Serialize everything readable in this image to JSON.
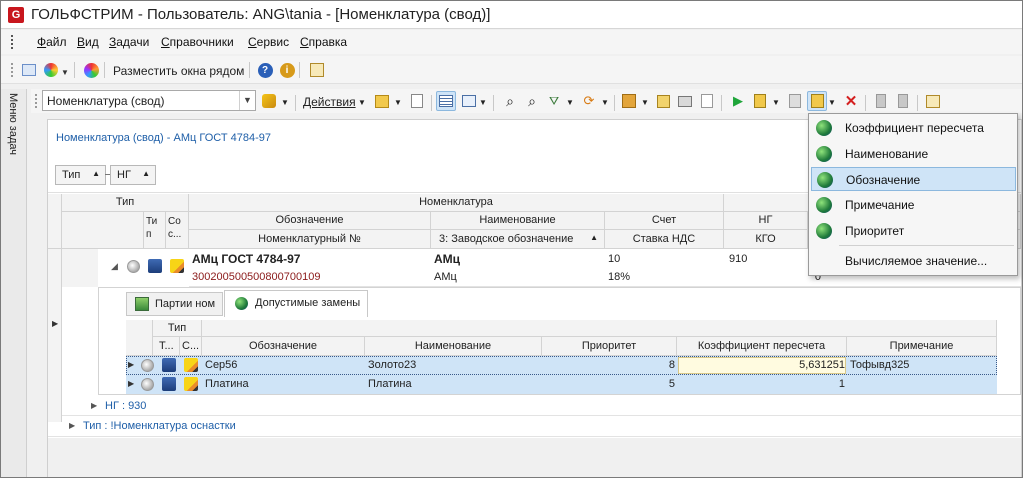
{
  "window": {
    "title": "ГОЛЬФСТРИМ - Пользователь: ANG\\tania - [Номенклатура (свод)]",
    "app_icon_letter": "G"
  },
  "menu": {
    "items": [
      "Файл",
      "Вид",
      "Задачи",
      "Справочники",
      "Сервис",
      "Справка"
    ]
  },
  "toolbar1": {
    "arrange_label": "Разместить окна рядом"
  },
  "sidebar": {
    "tab_label": "Меню задач"
  },
  "toolbar2": {
    "view_combo_value": "Номенклатура (свод)",
    "actions_label": "Действия"
  },
  "breadcrumb": "Номенклатура (свод) - АМц ГОСТ 4784-97",
  "group_chips": [
    "Тип",
    "НГ"
  ],
  "main_grid": {
    "band_headers": {
      "type": "Тип",
      "nomenclature": "Номенклатура"
    },
    "columns_row1": {
      "tip_short": "Ти п",
      "sos": "Со с...",
      "designation": "Обозначение",
      "name": "Наименование",
      "account": "Счет",
      "ng": "НГ"
    },
    "columns_row2": {
      "nomenclature_no": "Номенклатурный №",
      "factory_designation": "3: Заводское обозначение",
      "vat_rate": "Ставка НДС",
      "kgo": "КГО"
    },
    "record": {
      "designation": "АМц ГОСТ 4784-97",
      "name": "АМц",
      "account": "10",
      "ng": "910",
      "nomenclature_no": "3002005005008007001 09",
      "nomenclature_no_display": "300200500500800700109",
      "factory_designation": "АМц",
      "vat_rate": "18%",
      "kgo": "0"
    },
    "group_rows": [
      {
        "label": "НГ : 930"
      },
      {
        "label": "Тип : !Номенклатура оснастки"
      }
    ]
  },
  "detail_tabs": [
    {
      "label": "Партии ном"
    },
    {
      "label": "Допустимые замены"
    }
  ],
  "detail_grid": {
    "headers": {
      "type_band": "Тип",
      "t": "Т...",
      "c": "С...",
      "designation": "Обозначение",
      "name": "Наименование",
      "priority": "Приоритет",
      "coefficient": "Коэффициент пересчета",
      "note": "Примечание"
    },
    "rows": [
      {
        "designation": "Сер56",
        "name": "Золото23",
        "priority": "8",
        "coefficient": "5,631251",
        "note": "Тофывд325"
      },
      {
        "designation": "Платина",
        "name": "Платина",
        "priority": "5",
        "coefficient": "1",
        "note": ""
      }
    ]
  },
  "dropdown_menu": {
    "items": [
      {
        "label": "Коэффициент пересчета",
        "icon": "globe-icon",
        "selected": false
      },
      {
        "label": "Наименование",
        "icon": "globe-icon",
        "selected": false
      },
      {
        "label": "Обозначение",
        "icon": "globe-icon",
        "selected": true
      },
      {
        "label": "Примечание",
        "icon": "globe-icon",
        "selected": false
      },
      {
        "label": "Приоритет",
        "icon": "globe-icon",
        "selected": false
      },
      {
        "label": "Вычисляемое значение...",
        "icon": "",
        "selected": false
      }
    ]
  },
  "colors": {
    "selection_blue": "#cfe4f7",
    "link_blue": "#1f5fa8",
    "nomenclature_no_red": "#8b1a1a",
    "coefficient_highlight": "#fffbe0"
  }
}
